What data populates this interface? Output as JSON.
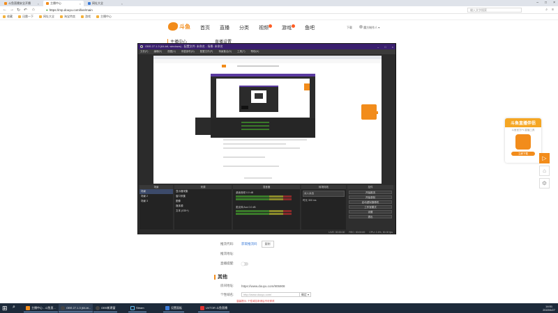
{
  "browser": {
    "tabs": [
      {
        "label": "斗鱼直播安全开播",
        "active": false,
        "color": "#f28c1b"
      },
      {
        "label": "主播中心",
        "active": true,
        "color": "#f28c1b"
      },
      {
        "label": "网址大全",
        "active": false,
        "color": "#3b7bd8"
      }
    ],
    "url": "https://mp.douyu.com/live/main",
    "search_placeholder": "输入文字搜索",
    "bookmarks": [
      "收藏",
      "迅雷一下",
      "网址大全",
      "淘宝特卖",
      "游戏",
      "主播中心"
    ]
  },
  "site": {
    "logo_text": "斗鱼",
    "nav": [
      "首页",
      "直播",
      "分类",
      "视频",
      "游戏",
      "鱼吧"
    ],
    "download": "下载",
    "username": "魔方制作人",
    "left_heading": "主播中心",
    "page_heading": "直播设置"
  },
  "settings": {
    "rows": [
      {
        "label": "推流代码:",
        "link": "获取推流码",
        "button": "复制"
      },
      {
        "label": "推流地址:"
      },
      {
        "label": "直播提醒:"
      }
    ],
    "other_title": "其他",
    "room_url_label": "房间地址:",
    "room_url": "https://www.douyu.com/905908",
    "stream_label": "个性域名:",
    "stream_placeholder": "http://www.douyu.com/",
    "stream_select": "确定",
    "warning": "温馨提示: 个性域名申请后不可修改"
  },
  "promo": {
    "title": "斗鱼直播伴侣",
    "subtitle": "斗鱼官方PC直播工具",
    "download": "立即下载"
  },
  "obs": {
    "title": "OBS 27.1.3 (64-bit, windows) - 配置文件: 未命名 - 场景: 未命名",
    "menu": [
      "文件(F)",
      "编辑(E)",
      "视图(V)",
      "停靠部件(D)",
      "配置文件(P)",
      "场景集合(S)",
      "工具(T)",
      "帮助(H)"
    ],
    "scene_header": "场景",
    "source_header": "来源",
    "mixer_header": "混音器",
    "transition_header": "转场特效",
    "controls_header": "控件",
    "scenes": [
      "场景",
      "场景 2",
      "场景 3"
    ],
    "sources": [
      "显示器采集",
      "窗口采集",
      "图像",
      "媒体源",
      "文本 (GDI+)"
    ],
    "mixer": [
      {
        "name": "桌面音频",
        "level": "0.0 dB"
      },
      {
        "name": "麦克风/Aux",
        "level": "0.0 dB"
      }
    ],
    "transition": "淡入淡出",
    "duration_label": "时长",
    "duration": "300 ms",
    "controls": [
      "开始推流",
      "开始录制",
      "启动虚拟摄像机",
      "工作室模式",
      "设置",
      "退出"
    ],
    "status": {
      "live": "LIVE: 00:00:00",
      "rec": "REC: 00:00:00",
      "cpu": "CPU: 2.4%, 30.00 fps"
    }
  },
  "taskbar": {
    "items": [
      {
        "label": "主播中心 - 斗鱼直...",
        "color": "#f28c1b"
      },
      {
        "label": "OBS 27.1.3 (64-bi...",
        "color": "#444"
      },
      {
        "label": "OBS新建窗",
        "color": "#444"
      },
      {
        "label": "Steam",
        "color": "#1b2838"
      },
      {
        "label": "设置面板",
        "color": "#3b7bd8"
      },
      {
        "label": "UVTOR 斗鱼直播",
        "color": "#d33"
      }
    ],
    "time": "14:51",
    "date": "2022/6/27"
  },
  "colors": {
    "brand": "#f28c1b",
    "obs_title": "#3a1f6e",
    "taskbar": "#1d2a3a"
  }
}
